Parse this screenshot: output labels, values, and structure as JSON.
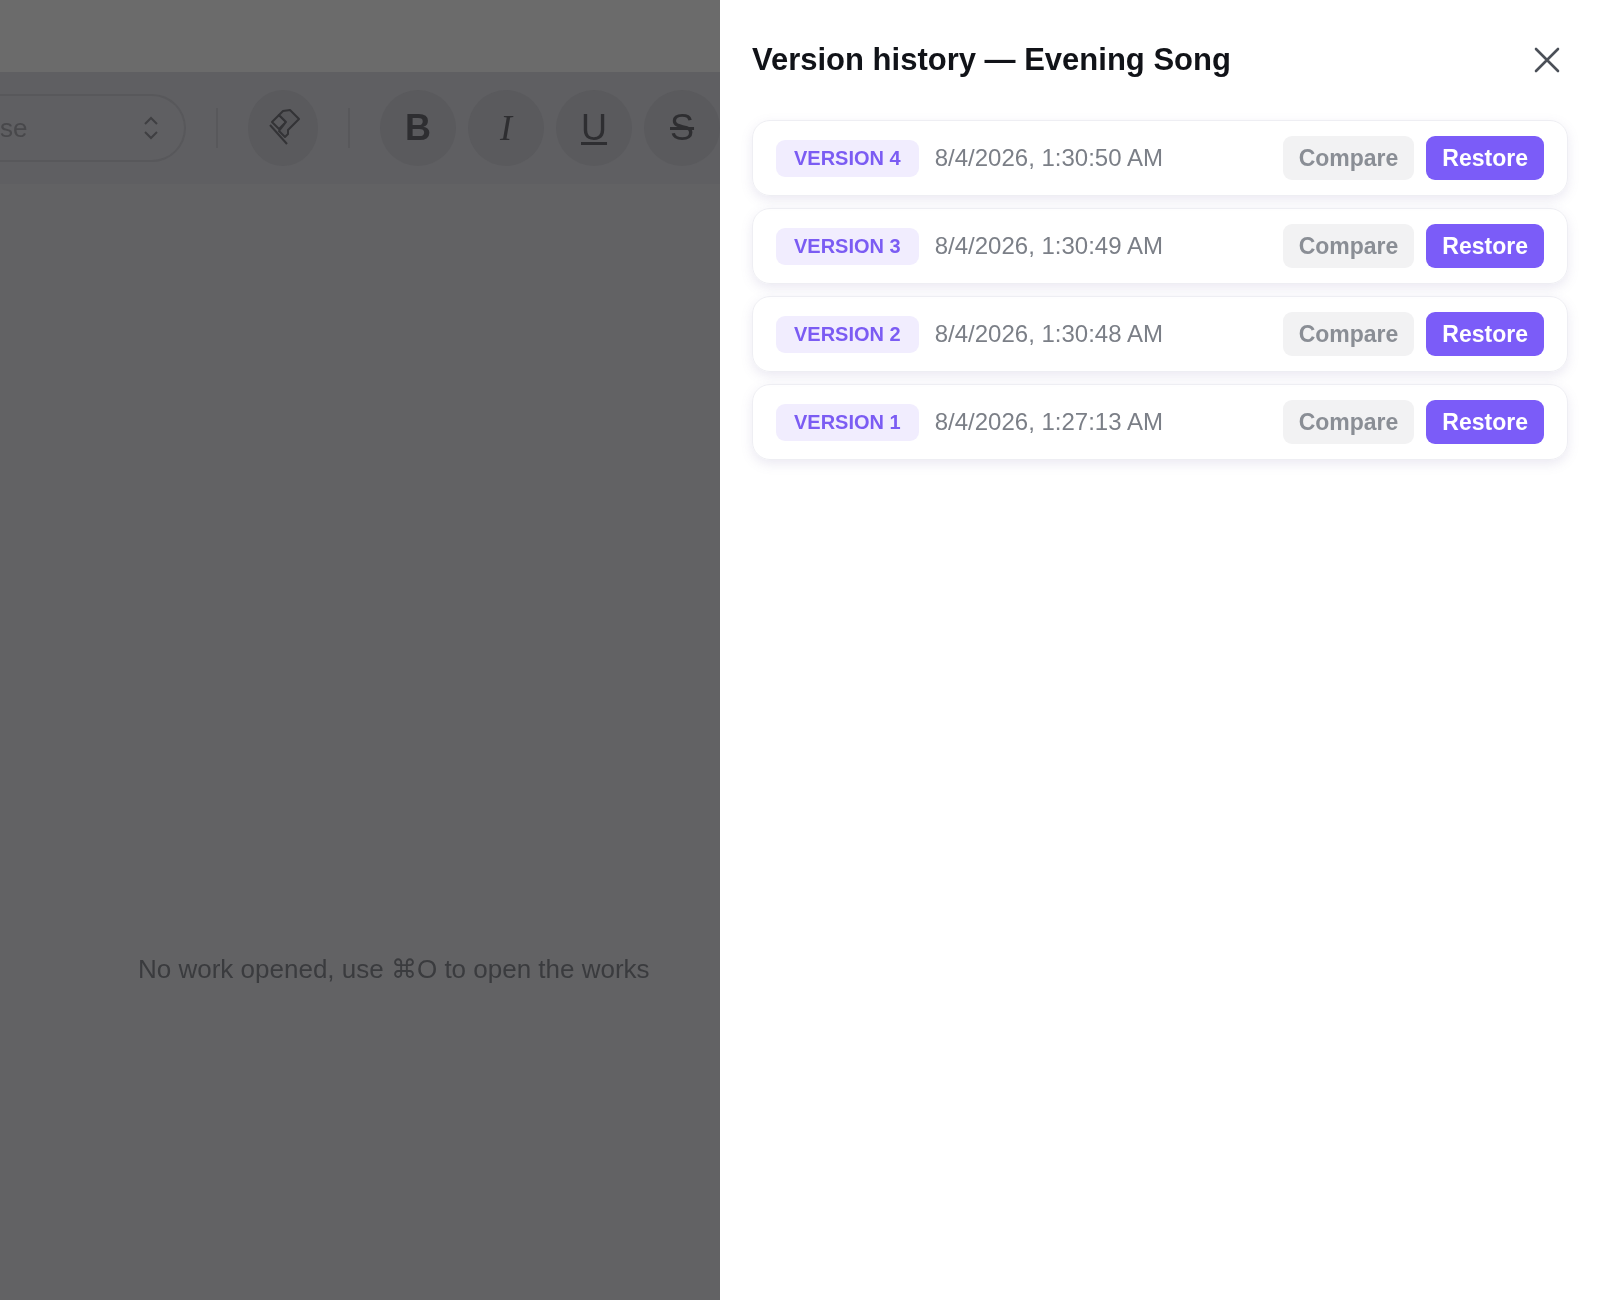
{
  "editor": {
    "toolbar": {
      "select": {
        "value": "se"
      },
      "format_buttons": [
        {
          "label": "B",
          "kind": "bold"
        },
        {
          "label": "I",
          "kind": "italic"
        },
        {
          "label": "U",
          "kind": "underline"
        },
        {
          "label": "S",
          "kind": "strike"
        }
      ]
    },
    "empty_message": "No work opened, use ⌘O to open the works"
  },
  "panel": {
    "title": "Version history — Evening Song",
    "versions": [
      {
        "badge": "VERSION 4",
        "timestamp": "8/4/2026, 1:30:50 AM",
        "compare": "Compare",
        "restore": "Restore"
      },
      {
        "badge": "VERSION 3",
        "timestamp": "8/4/2026, 1:30:49 AM",
        "compare": "Compare",
        "restore": "Restore"
      },
      {
        "badge": "VERSION 2",
        "timestamp": "8/4/2026, 1:30:48 AM",
        "compare": "Compare",
        "restore": "Restore"
      },
      {
        "badge": "VERSION 1",
        "timestamp": "8/4/2026, 1:27:13 AM",
        "compare": "Compare",
        "restore": "Restore"
      }
    ]
  }
}
